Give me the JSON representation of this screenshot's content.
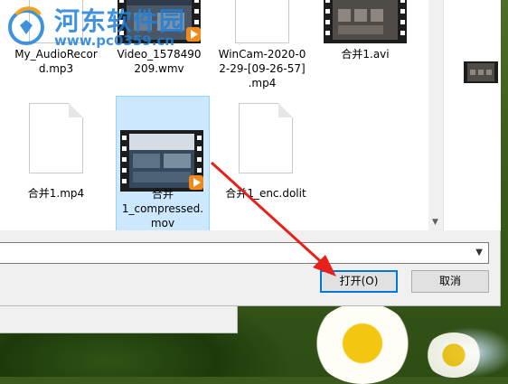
{
  "watermark": {
    "title": "河东软件园",
    "url": "www.pc0359.cn"
  },
  "files": [
    {
      "name": "My_AudioRecord.mp3",
      "label": "My_AudioRecor\nd.mp3",
      "type": "doc"
    },
    {
      "name": "Video_1578490209.wmv",
      "label": "Video_1578490\n209.wmv",
      "type": "video"
    },
    {
      "name": "WinCam-2020-02-29-[09-26-57].mp4",
      "label": "WinCam-2020-0\n2-29-[09-26-57]\n.mp4",
      "type": "doc"
    },
    {
      "name": "合并1.avi",
      "label": "合并1.avi",
      "type": "video"
    },
    {
      "name": "合并1.mp4",
      "label": "合并1.mp4",
      "type": "doc"
    },
    {
      "name": "合并1_compressed.mov",
      "label": "合并\n1_compressed.\nmov",
      "type": "video",
      "selected": true
    },
    {
      "name": "合并1_enc.dolit",
      "label": "合并1_enc.dolit",
      "type": "doc"
    }
  ],
  "footer": {
    "filename_value": "",
    "open_label": "打开(O)",
    "cancel_label": "取消"
  },
  "colors": {
    "selection": "#cce8ff",
    "accent": "#0078d7",
    "arrow": "#e8201c"
  }
}
